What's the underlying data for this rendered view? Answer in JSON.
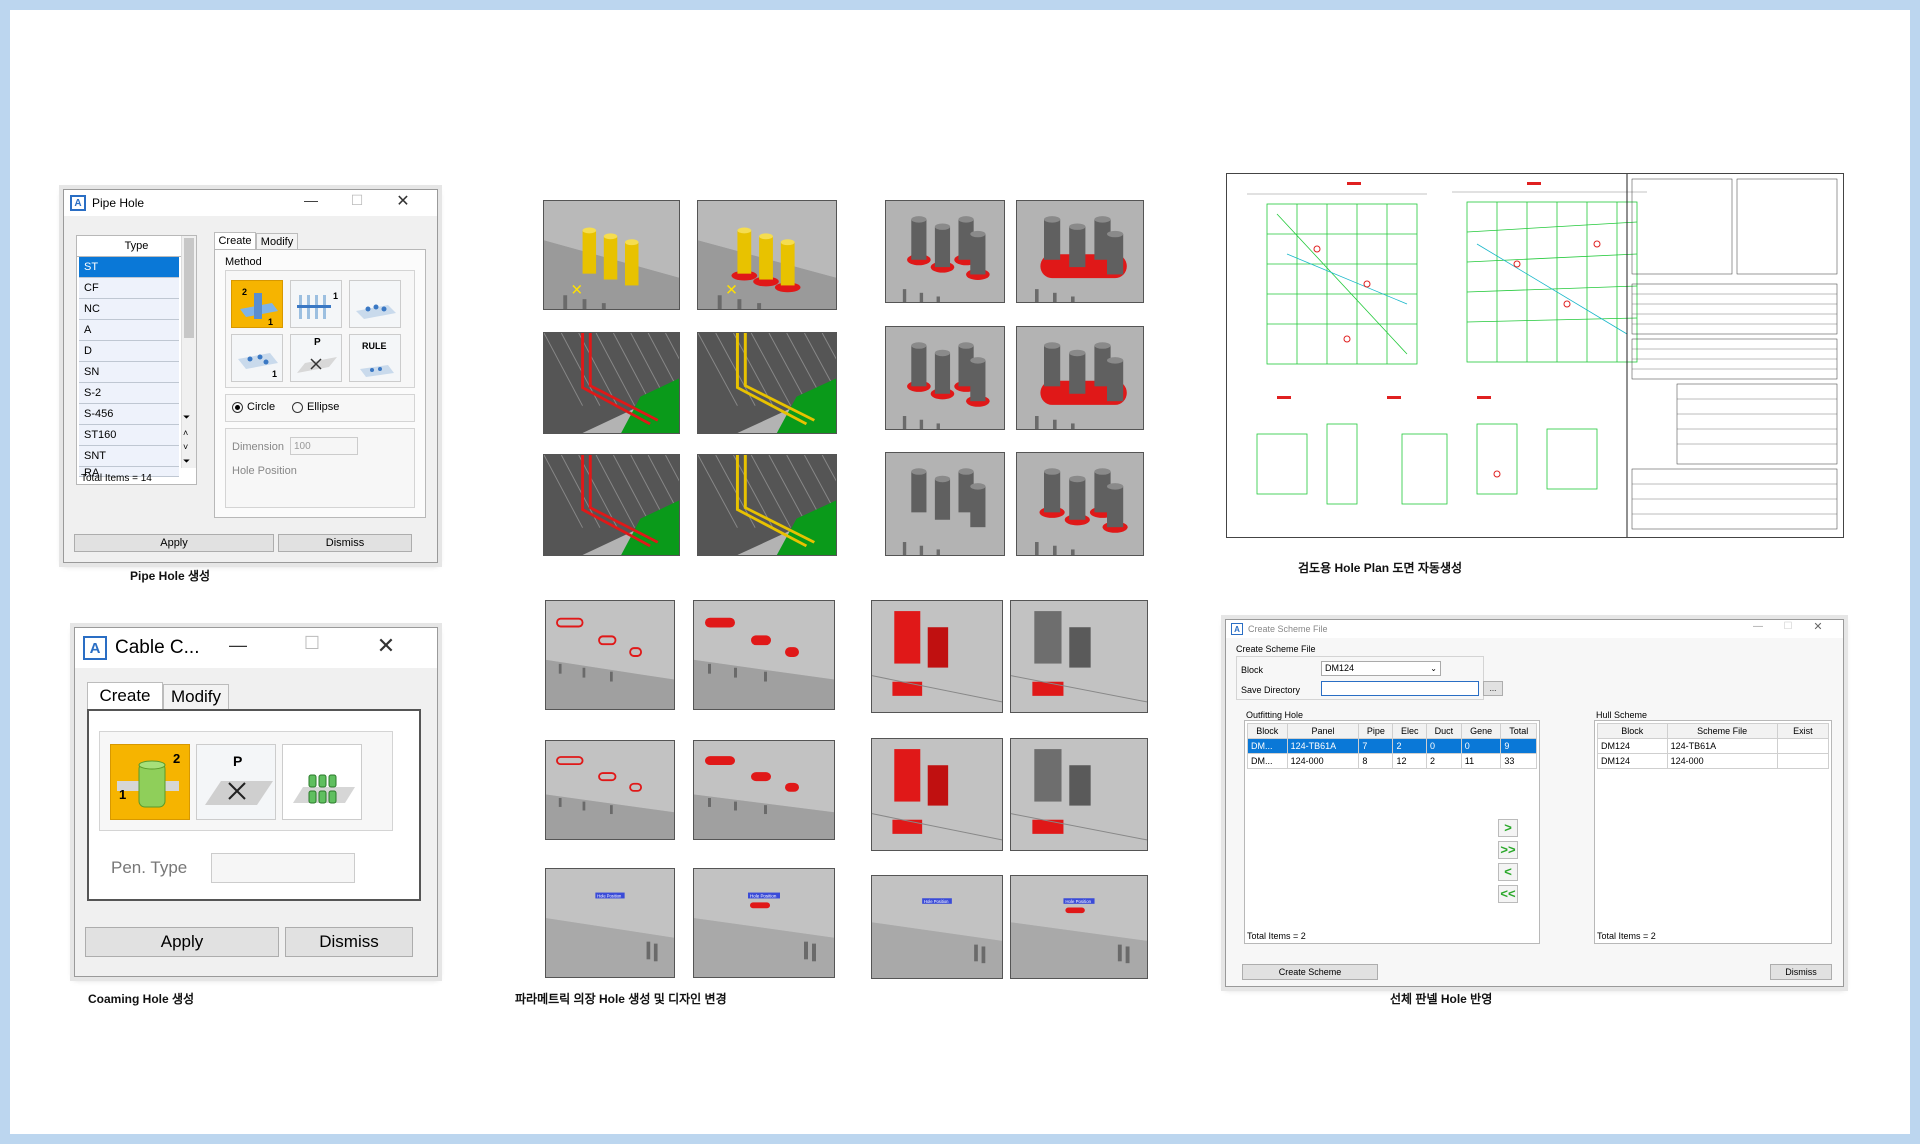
{
  "pipe_hole": {
    "title": "Pipe Hole",
    "tabs": [
      "Create",
      "Modify"
    ],
    "list_header": "Type",
    "types": [
      "ST",
      "CF",
      "NC",
      "A",
      "D",
      "SN",
      "S-2",
      "S-456",
      "ST160",
      "SNT",
      "RA"
    ],
    "total": "Total Items = 14",
    "method_label": "Method",
    "tile_rule": "RULE",
    "tile_p": "P",
    "circle": "Circle",
    "ellipse": "Ellipse",
    "dimension_label": "Dimension",
    "dimension_value": "100",
    "hole_position_label": "Hole Position",
    "apply": "Apply",
    "dismiss": "Dismiss",
    "caption": "Pipe Hole 생성"
  },
  "cable_hole": {
    "title": "Cable C...",
    "tabs": [
      "Create",
      "Modify"
    ],
    "pen_type_label": "Pen. Type",
    "tile_p": "P",
    "apply": "Apply",
    "dismiss": "Dismiss",
    "caption": "Coaming Hole 생성"
  },
  "parametric": {
    "caption": "파라메트릭 의장 Hole 생성 및 디자인 변경",
    "hole_position_tag": "Hole Position"
  },
  "drawing": {
    "caption": "검도용 Hole Plan 도면 자동생성"
  },
  "scheme": {
    "title": "Create Scheme File",
    "group_label": "Create Scheme File",
    "block_label": "Block",
    "block_value": "DM124",
    "save_dir_label": "Save Directory",
    "browse": "...",
    "outfitting_label": "Outfitting Hole",
    "out_headers": [
      "Block",
      "Panel",
      "Pipe",
      "Elec",
      "Duct",
      "Gene",
      "Total"
    ],
    "out_rows": [
      [
        "DM...",
        "124-TB61A",
        "7",
        "2",
        "0",
        "0",
        "9"
      ],
      [
        "DM...",
        "124-000",
        "8",
        "12",
        "2",
        "11",
        "33"
      ]
    ],
    "out_total": "Total Items = 2",
    "hull_label": "Hull Scheme",
    "hull_headers": [
      "Block",
      "Scheme File",
      "Exist"
    ],
    "hull_rows": [
      [
        "DM124",
        "124-TB61A",
        ""
      ],
      [
        "DM124",
        "124-000",
        ""
      ]
    ],
    "hull_total": "Total Items = 2",
    "arrows": [
      ">",
      ">>",
      "<",
      "<<"
    ],
    "create_btn": "Create Scheme",
    "dismiss": "Dismiss",
    "caption": "선체 판넬 Hole 반영"
  },
  "colors": {
    "accent": "#0a78d7",
    "selected_tile": "#f6b400",
    "hole_red": "#e01818",
    "pipe_yellow": "#e8c200",
    "deck_green": "#0a9a1a",
    "plate_gray": "#b3b3b3"
  }
}
